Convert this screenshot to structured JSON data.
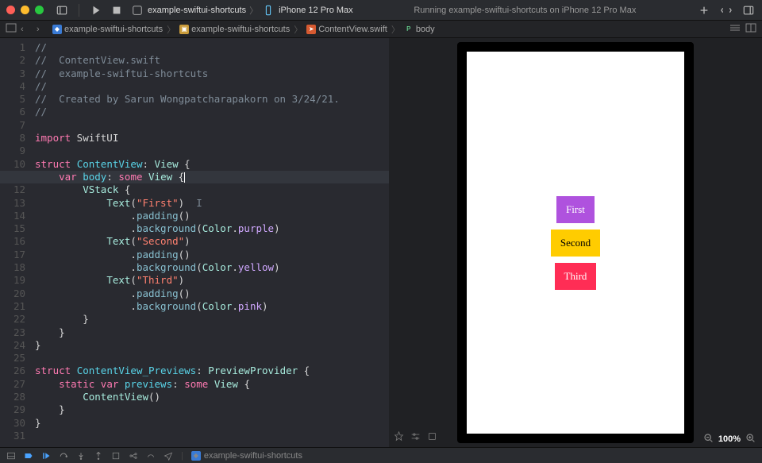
{
  "titlebar": {
    "scheme_name": "example-swiftui-shortcuts",
    "device": "iPhone 12 Pro Max",
    "status": "Running example-swiftui-shortcuts on iPhone 12 Pro Max"
  },
  "breadcrumb": {
    "project": "example-swiftui-shortcuts",
    "group": "example-swiftui-shortcuts",
    "file": "ContentView.swift",
    "symbol": "body"
  },
  "code": {
    "lines": [
      {
        "n": "1",
        "seg": [
          {
            "t": "//",
            "c": "c-comment"
          }
        ]
      },
      {
        "n": "2",
        "seg": [
          {
            "t": "//  ContentView.swift",
            "c": "c-comment"
          }
        ]
      },
      {
        "n": "3",
        "seg": [
          {
            "t": "//  example-swiftui-shortcuts",
            "c": "c-comment"
          }
        ]
      },
      {
        "n": "4",
        "seg": [
          {
            "t": "//",
            "c": "c-comment"
          }
        ]
      },
      {
        "n": "5",
        "seg": [
          {
            "t": "//  Created by Sarun Wongpatcharapakorn on 3/24/21.",
            "c": "c-comment"
          }
        ]
      },
      {
        "n": "6",
        "seg": [
          {
            "t": "//",
            "c": "c-comment"
          }
        ]
      },
      {
        "n": "7",
        "seg": []
      },
      {
        "n": "8",
        "seg": [
          {
            "t": "import",
            "c": "c-key"
          },
          {
            "t": " SwiftUI",
            "c": ""
          }
        ]
      },
      {
        "n": "9",
        "seg": []
      },
      {
        "n": "10",
        "seg": [
          {
            "t": "struct",
            "c": "c-key"
          },
          {
            "t": " ",
            "c": ""
          },
          {
            "t": "ContentView",
            "c": "c-name"
          },
          {
            "t": ": ",
            "c": ""
          },
          {
            "t": "View",
            "c": "c-type"
          },
          {
            "t": " {",
            "c": ""
          }
        ]
      },
      {
        "n": "11",
        "hl": true,
        "seg": [
          {
            "t": "    ",
            "c": ""
          },
          {
            "t": "var",
            "c": "c-key"
          },
          {
            "t": " ",
            "c": ""
          },
          {
            "t": "body",
            "c": "c-name"
          },
          {
            "t": ": ",
            "c": ""
          },
          {
            "t": "some",
            "c": "c-key"
          },
          {
            "t": " ",
            "c": ""
          },
          {
            "t": "View",
            "c": "c-type"
          },
          {
            "t": " {",
            "c": ""
          }
        ],
        "cursor": true
      },
      {
        "n": "12",
        "seg": [
          {
            "t": "        ",
            "c": ""
          },
          {
            "t": "VStack",
            "c": "c-type"
          },
          {
            "t": " {",
            "c": ""
          }
        ]
      },
      {
        "n": "13",
        "seg": [
          {
            "t": "            ",
            "c": ""
          },
          {
            "t": "Text",
            "c": "c-type"
          },
          {
            "t": "(",
            "c": ""
          },
          {
            "t": "\"First\"",
            "c": "c-str"
          },
          {
            "t": ")  ",
            "c": ""
          },
          {
            "t": "I",
            "c": "c-comment"
          }
        ]
      },
      {
        "n": "14",
        "seg": [
          {
            "t": "                .",
            "c": ""
          },
          {
            "t": "padding",
            "c": "c-func"
          },
          {
            "t": "()",
            "c": ""
          }
        ]
      },
      {
        "n": "15",
        "seg": [
          {
            "t": "                .",
            "c": ""
          },
          {
            "t": "background",
            "c": "c-func"
          },
          {
            "t": "(",
            "c": ""
          },
          {
            "t": "Color",
            "c": "c-type"
          },
          {
            "t": ".",
            "c": ""
          },
          {
            "t": "purple",
            "c": "c-prop"
          },
          {
            "t": ")",
            "c": ""
          }
        ]
      },
      {
        "n": "16",
        "seg": [
          {
            "t": "            ",
            "c": ""
          },
          {
            "t": "Text",
            "c": "c-type"
          },
          {
            "t": "(",
            "c": ""
          },
          {
            "t": "\"Second\"",
            "c": "c-str"
          },
          {
            "t": ")",
            "c": ""
          }
        ]
      },
      {
        "n": "17",
        "seg": [
          {
            "t": "                .",
            "c": ""
          },
          {
            "t": "padding",
            "c": "c-func"
          },
          {
            "t": "()",
            "c": ""
          }
        ]
      },
      {
        "n": "18",
        "seg": [
          {
            "t": "                .",
            "c": ""
          },
          {
            "t": "background",
            "c": "c-func"
          },
          {
            "t": "(",
            "c": ""
          },
          {
            "t": "Color",
            "c": "c-type"
          },
          {
            "t": ".",
            "c": ""
          },
          {
            "t": "yellow",
            "c": "c-prop"
          },
          {
            "t": ")",
            "c": ""
          }
        ]
      },
      {
        "n": "19",
        "seg": [
          {
            "t": "            ",
            "c": ""
          },
          {
            "t": "Text",
            "c": "c-type"
          },
          {
            "t": "(",
            "c": ""
          },
          {
            "t": "\"Third\"",
            "c": "c-str"
          },
          {
            "t": ")",
            "c": ""
          }
        ]
      },
      {
        "n": "20",
        "seg": [
          {
            "t": "                .",
            "c": ""
          },
          {
            "t": "padding",
            "c": "c-func"
          },
          {
            "t": "()",
            "c": ""
          }
        ]
      },
      {
        "n": "21",
        "seg": [
          {
            "t": "                .",
            "c": ""
          },
          {
            "t": "background",
            "c": "c-func"
          },
          {
            "t": "(",
            "c": ""
          },
          {
            "t": "Color",
            "c": "c-type"
          },
          {
            "t": ".",
            "c": ""
          },
          {
            "t": "pink",
            "c": "c-prop"
          },
          {
            "t": ")",
            "c": ""
          }
        ]
      },
      {
        "n": "22",
        "seg": [
          {
            "t": "        }",
            "c": ""
          }
        ]
      },
      {
        "n": "23",
        "seg": [
          {
            "t": "    }",
            "c": ""
          }
        ]
      },
      {
        "n": "24",
        "seg": [
          {
            "t": "}",
            "c": ""
          }
        ]
      },
      {
        "n": "25",
        "seg": []
      },
      {
        "n": "26",
        "seg": [
          {
            "t": "struct",
            "c": "c-key"
          },
          {
            "t": " ",
            "c": ""
          },
          {
            "t": "ContentView_Previews",
            "c": "c-name"
          },
          {
            "t": ": ",
            "c": ""
          },
          {
            "t": "PreviewProvider",
            "c": "c-type"
          },
          {
            "t": " {",
            "c": ""
          }
        ]
      },
      {
        "n": "27",
        "seg": [
          {
            "t": "    ",
            "c": ""
          },
          {
            "t": "static",
            "c": "c-key"
          },
          {
            "t": " ",
            "c": ""
          },
          {
            "t": "var",
            "c": "c-key"
          },
          {
            "t": " ",
            "c": ""
          },
          {
            "t": "previews",
            "c": "c-name"
          },
          {
            "t": ": ",
            "c": ""
          },
          {
            "t": "some",
            "c": "c-key"
          },
          {
            "t": " ",
            "c": ""
          },
          {
            "t": "View",
            "c": "c-type"
          },
          {
            "t": " {",
            "c": ""
          }
        ]
      },
      {
        "n": "28",
        "seg": [
          {
            "t": "        ",
            "c": ""
          },
          {
            "t": "ContentView",
            "c": "c-type"
          },
          {
            "t": "()",
            "c": ""
          }
        ]
      },
      {
        "n": "29",
        "seg": [
          {
            "t": "    }",
            "c": ""
          }
        ]
      },
      {
        "n": "30",
        "seg": [
          {
            "t": "}",
            "c": ""
          }
        ]
      },
      {
        "n": "31",
        "seg": []
      }
    ]
  },
  "preview": {
    "items": [
      {
        "text": "First",
        "cls": "purple"
      },
      {
        "text": "Second",
        "cls": "yellow"
      },
      {
        "text": "Third",
        "cls": "pink"
      }
    ],
    "zoom": "100%"
  },
  "debugbar": {
    "target": "example-swiftui-shortcuts"
  }
}
